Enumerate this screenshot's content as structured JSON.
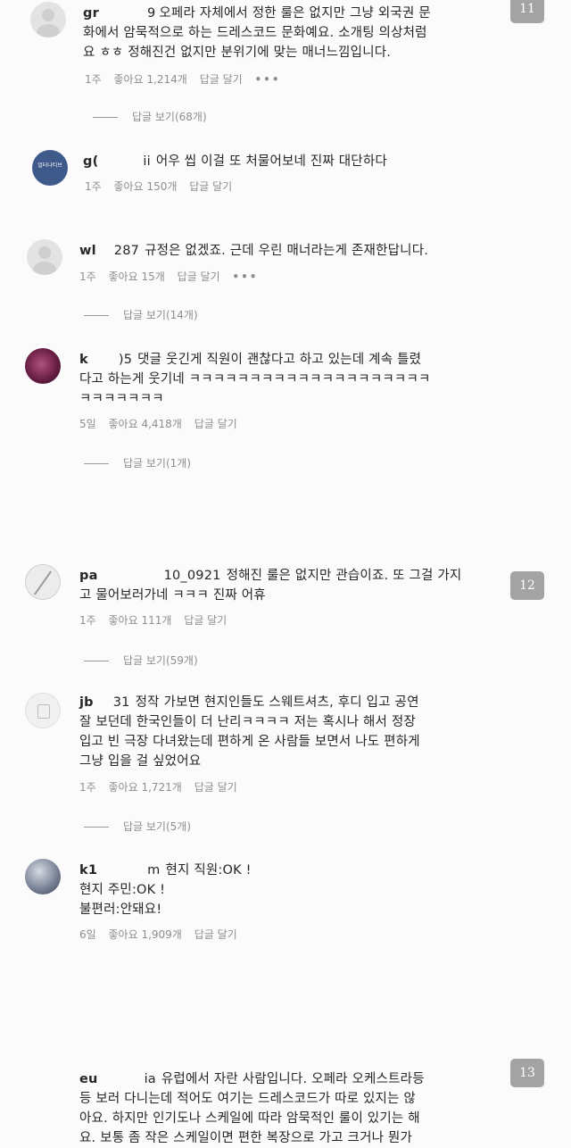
{
  "page_badges": [
    "11",
    "12",
    "13"
  ],
  "comments": [
    {
      "username": "gr",
      "handle_suffix": "9",
      "text": "오페라 자체에서 정한 룰은 없지만 그냥 외국권 문\n화에서 암묵적으로 하는 드레스코드 문화예요. 소개팅 의상처럼\n요 ㅎㅎ 정해진건 없지만 분위기에 맞는 매너느낌입니다.",
      "time": "1주",
      "likes": "좋아요 1,214개",
      "reply": "답글 달기",
      "more": "•••",
      "view_replies": "답글 보기(68개)"
    },
    {
      "username": "g(",
      "handle_suffix": "ii",
      "avatar_text": "얼터나티브",
      "text": "어우 씹 이걸 또 처물어보네 진짜 대단하다",
      "time": "1주",
      "likes": "좋아요 150개",
      "reply": "답글 달기"
    },
    {
      "username": "wl",
      "handle_suffix": "287",
      "text": "규정은 없겠죠. 근데 우린 매너라는게 존재한답니다.",
      "time": "1주",
      "likes": "좋아요 15개",
      "reply": "답글 달기",
      "more": "•••",
      "view_replies": "답글 보기(14개)"
    },
    {
      "username": "k",
      "handle_suffix": ")5",
      "text": "댓글 웃긴게 직원이 괜찮다고 하고 있는데 계속 틀렸\n다고 하는게 웃기네 ㅋㅋㅋㅋㅋㅋㅋㅋㅋㅋㅋㅋㅋㅋㅋㅋㅋㅋㅋㅋ\nㅋㅋㅋㅋㅋㅋㅋ",
      "time": "5일",
      "likes": "좋아요 4,418개",
      "reply": "답글 달기",
      "view_replies": "답글 보기(1개)"
    },
    {
      "username": "pa",
      "handle_suffix": "10_0921",
      "text": "정해진 룰은 없지만 관습이죠. 또 그걸 가지\n고 물어보러가네 ㅋㅋㅋ 진짜 어휴",
      "time": "1주",
      "likes": "좋아요 111개",
      "reply": "답글 달기",
      "view_replies": "답글 보기(59개)"
    },
    {
      "username": "jb",
      "handle_suffix": "31",
      "text": "정작 가보면 현지인들도 스웨트셔츠, 후디 입고 공연\n잘 보던데 한국인들이 더 난리ㅋㅋㅋㅋ 저는 혹시나 해서 정장\n입고 빈 극장 다녀왔는데 편하게 온 사람들 보면서 나도 편하게\n그냥 입을 걸 싶었어요",
      "time": "1주",
      "likes": "좋아요 1,721개",
      "reply": "답글 달기",
      "view_replies": "답글 보기(5개)"
    },
    {
      "username": "k1",
      "handle_suffix": "m",
      "text": "현지 직원:OK !\n현지 주민:OK !\n불편러:안돼요!",
      "time": "6일",
      "likes": "좋아요 1,909개",
      "reply": "답글 달기"
    },
    {
      "username": "eu",
      "handle_suffix": "ia",
      "text": "유럽에서 자란 사람입니다. 오페라 오케스트라등\n등 보러 다니는데 적어도 여기는 드레스코드가 따로 있지는 않\n아요. 하지만 인기도나 스케일에 따라 암묵적인 룰이 있기는 해\n요. 보통 좀 작은 스케일이면 편한 복장으로 가고 크거나 뭔가"
    }
  ]
}
